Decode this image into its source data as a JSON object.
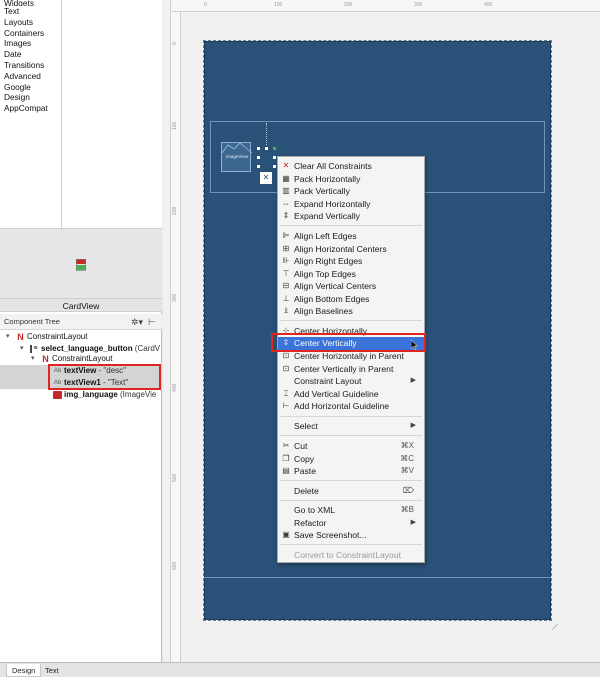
{
  "palette": {
    "categories": [
      "Widgets",
      "Text",
      "Layouts",
      "Containers",
      "Images",
      "Date",
      "Transitions",
      "Advanced",
      "Google",
      "Design",
      "AppCompat"
    ]
  },
  "preview_title": "CardView",
  "component_tree": {
    "title": "Component Tree",
    "rows": [
      {
        "name": "ConstraintLayout",
        "desc": "",
        "selected": false
      },
      {
        "name": "select_language_button",
        "desc": " (CardV",
        "selected": false
      },
      {
        "name": "ConstraintLayout",
        "desc": "",
        "selected": false
      },
      {
        "name": "textView",
        "desc": " - \"desc\"",
        "selected": true
      },
      {
        "name": "textView1",
        "desc": " - \"Text\"",
        "selected": true
      },
      {
        "name": "img_language",
        "desc": " (ImageVie",
        "selected": false
      }
    ]
  },
  "canvas": {
    "image_view_label": "ImageView",
    "ruler_top": [
      "0",
      "100",
      "200",
      "300",
      "400"
    ],
    "ruler_left": [
      "0",
      "100",
      "200",
      "300",
      "400",
      "500",
      "600"
    ]
  },
  "context_menu": {
    "items": [
      {
        "label": "Clear All Constraints",
        "icon": "clear-constraints-icon"
      },
      {
        "label": "Pack Horizontally",
        "icon": "pack-horizontal-icon"
      },
      {
        "label": "Pack Vertically",
        "icon": "pack-vertical-icon"
      },
      {
        "label": "Expand Horizontally",
        "icon": "expand-horizontal-icon"
      },
      {
        "label": "Expand Vertically",
        "icon": "expand-vertical-icon"
      },
      {
        "label": "Align Left Edges",
        "icon": "align-left-icon"
      },
      {
        "label": "Align Horizontal Centers",
        "icon": "align-hcenter-icon"
      },
      {
        "label": "Align Right Edges",
        "icon": "align-right-icon"
      },
      {
        "label": "Align Top Edges",
        "icon": "align-top-icon"
      },
      {
        "label": "Align Vertical Centers",
        "icon": "align-vcenter-icon"
      },
      {
        "label": "Align Bottom Edges",
        "icon": "align-bottom-icon"
      },
      {
        "label": "Align Baselines",
        "icon": "align-baseline-icon"
      },
      {
        "label": "Center Horizontally",
        "icon": "center-horizontal-icon"
      },
      {
        "label": "Center Vertically",
        "icon": "center-vertical-icon"
      },
      {
        "label": "Center Horizontally in Parent",
        "icon": "center-h-parent-icon"
      },
      {
        "label": "Center Vertically in Parent",
        "icon": "center-v-parent-icon"
      },
      {
        "label": "Constraint Layout",
        "icon": ""
      },
      {
        "label": "Add Vertical Guideline",
        "icon": "vertical-guideline-icon"
      },
      {
        "label": "Add Horizontal Guideline",
        "icon": "horizontal-guideline-icon"
      },
      {
        "label": "Select",
        "icon": ""
      },
      {
        "label": "Cut",
        "icon": "cut-icon",
        "shortcut": "⌘X"
      },
      {
        "label": "Copy",
        "icon": "copy-icon",
        "shortcut": "⌘C"
      },
      {
        "label": "Paste",
        "icon": "paste-icon",
        "shortcut": "⌘V"
      },
      {
        "label": "Delete",
        "icon": "",
        "shortcut": "⌦"
      },
      {
        "label": "Go to XML",
        "icon": "",
        "shortcut": "⌘B"
      },
      {
        "label": "Refactor",
        "icon": ""
      },
      {
        "label": "Save Screenshot...",
        "icon": "screenshot-icon"
      },
      {
        "label": "Convert to ConstraintLayout",
        "icon": ""
      }
    ],
    "highlighted_index": 13
  },
  "bottom_tabs": [
    "Design",
    "Text"
  ],
  "colors": {
    "accent": "#3b73d8",
    "annotation": "#e0241f",
    "canvas": "#2a5279"
  }
}
